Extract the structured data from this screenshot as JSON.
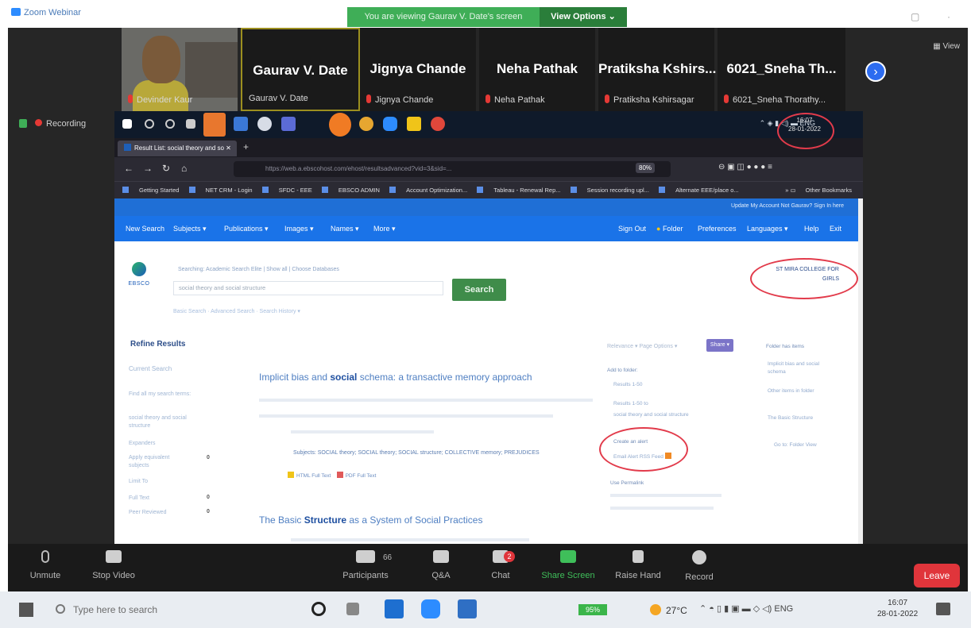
{
  "zoom": {
    "app_title": "Zoom Webinar",
    "viewing_banner": "You are viewing Gaurav V. Date's screen",
    "view_options": "View Options ⌄",
    "view_label": "View",
    "recording": "Recording",
    "participants": [
      {
        "display": "",
        "name": "Devinder Kaur",
        "video": true
      },
      {
        "display": "Gaurav V. Date",
        "name": "Gaurav V. Date",
        "video": false,
        "active": true
      },
      {
        "display": "Jignya Chande",
        "name": "Jignya Chande",
        "video": false
      },
      {
        "display": "Neha Pathak",
        "name": "Neha Pathak",
        "video": false
      },
      {
        "display": "Pratiksha Kshirs...",
        "name": "Pratiksha Kshirsagar",
        "video": false
      },
      {
        "display": "6021_Sneha Th...",
        "name": "6021_Sneha Thorathy...",
        "video": false
      }
    ],
    "toolbar": {
      "unmute": "Unmute",
      "stop_video": "Stop Video",
      "participants": "Participants",
      "participants_count": "66",
      "qa": "Q&A",
      "chat": "Chat",
      "chat_badge": "2",
      "share_screen": "Share Screen",
      "raise_hand": "Raise Hand",
      "record": "Record",
      "leave": "Leave"
    }
  },
  "shared_screen": {
    "clock_time": "16:07",
    "clock_date": "28-01-2022",
    "tray_lang": "ENG",
    "browser": {
      "tab_title": "Result List: social theory and so",
      "url": "https://web.a.ebscohost.com/ehost/resultsadvanced?vid=3&sid=...",
      "zoom": "80%",
      "bookmarks": [
        "Getting Started",
        "NET CRM - Login",
        "SFDC - EEE",
        "EBSCO ADMIN",
        "Account Optimization...",
        "Tableau - Renewal Rep...",
        "Session recording upl...",
        "Alternate EEE/place o..."
      ],
      "other_bookmarks": "Other Bookmarks"
    },
    "ebsco": {
      "top_links": "Update My Account   Not Gaurav?  Sign In here",
      "nav": [
        "New Search",
        "Subjects ▾",
        "Publications ▾",
        "Images ▾",
        "Names ▾",
        "More ▾"
      ],
      "nav_right": [
        "Sign Out",
        "Folder",
        "Preferences",
        "Languages ▾",
        "Help",
        "Exit"
      ],
      "logo_text": "EBSCO",
      "search_meta": "Searching: Academic Search Elite | Show all | Choose Databases",
      "search_value": "social theory and social structure",
      "search_button": "Search",
      "search_options": "Basic Search · Advanced Search · Search History ▾",
      "institution": "ST MIRA COLLEGE FOR GIRLS",
      "refine_title": "Refine Results",
      "current_search": "Current Search",
      "sidebar": [
        {
          "label": "Find all my search terms:",
          "count": ""
        },
        {
          "label": "social theory and social structure",
          "count": ""
        },
        {
          "label": "Expanders",
          "count": ""
        },
        {
          "label": "Apply equivalent subjects",
          "count": "0"
        },
        {
          "label": "Limit To",
          "count": ""
        },
        {
          "label": "Full Text",
          "count": "0"
        },
        {
          "label": "Peer Reviewed",
          "count": "0"
        }
      ],
      "sort_text": "Relevance ▾  Page Options ▾",
      "share": "Share ▾",
      "results": [
        {
          "prefix": "Implicit bias and ",
          "bold": "social",
          "suffix": " schema: a transactive memory approach"
        },
        {
          "prefix": "The Basic ",
          "bold": "Structure",
          "suffix": " as a System of Social Practices"
        }
      ],
      "subjects_line": "Subjects: SOCIAL theory; SOCIAL theory; SOCIAL structure; COLLECTIVE memory; PREJUDICES",
      "full_text": [
        "HTML Full Text",
        "PDF Full Text"
      ],
      "add_to_folder": "Add to folder:",
      "add_items": [
        "Results 1-50",
        "Results 1-50 to",
        "social theory and social structure"
      ],
      "create_alert": "Create an alert",
      "alert_links": "Email Alert  RSS Feed",
      "use_permalink": "Use Permalink",
      "folder_title": "Folder has items",
      "folder_items": [
        "Implicit bias and social schema",
        "Other items in folder",
        "The Basic Structure"
      ],
      "folder_view": "Go to: Folder View"
    }
  },
  "taskbar": {
    "search_placeholder": "Type here to search",
    "battery": "95%",
    "weather": "27°C",
    "lang": "ENG",
    "time": "16:07",
    "date": "28-01-2022"
  }
}
